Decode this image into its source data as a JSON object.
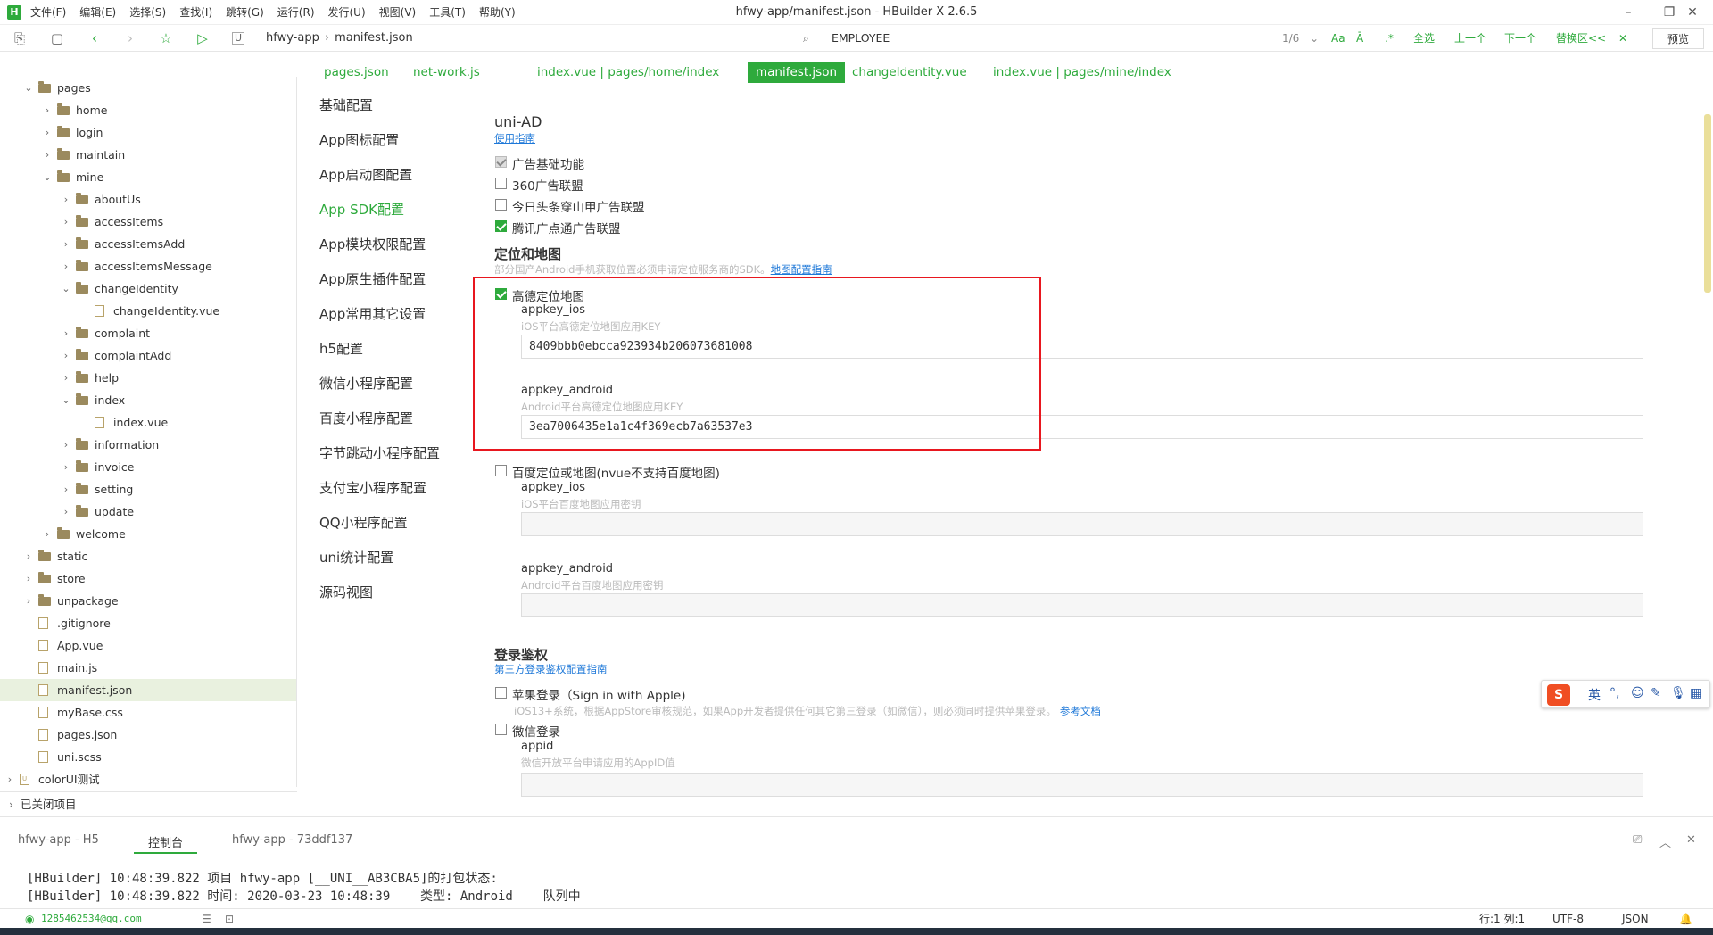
{
  "window": {
    "title": "hfwy-app/manifest.json - HBuilder X 2.6.5",
    "logo": "H"
  },
  "menu": [
    "文件(F)",
    "编辑(E)",
    "选择(S)",
    "查找(I)",
    "跳转(G)",
    "运行(R)",
    "发行(U)",
    "视图(V)",
    "工具(T)",
    "帮助(Y)"
  ],
  "breadcrumb": {
    "project": "hfwy-app",
    "file": "manifest.json"
  },
  "find": {
    "value": "EMPLOYEE",
    "count": "1/6",
    "case_label": "Aa",
    "word_label": "Ā",
    "regex_label": ".*",
    "select_all": "全选",
    "prev": "上一个",
    "next": "下一个",
    "replace": "替换区<<",
    "close": "✕",
    "preview": "预览"
  },
  "tree": [
    {
      "depth": 1,
      "type": "folder",
      "open": true,
      "label": "pages"
    },
    {
      "depth": 2,
      "type": "folder",
      "open": false,
      "label": "home"
    },
    {
      "depth": 2,
      "type": "folder",
      "open": false,
      "label": "login"
    },
    {
      "depth": 2,
      "type": "folder",
      "open": false,
      "label": "maintain"
    },
    {
      "depth": 2,
      "type": "folder",
      "open": true,
      "label": "mine"
    },
    {
      "depth": 3,
      "type": "folder",
      "open": false,
      "label": "aboutUs"
    },
    {
      "depth": 3,
      "type": "folder",
      "open": false,
      "label": "accessItems"
    },
    {
      "depth": 3,
      "type": "folder",
      "open": false,
      "label": "accessItemsAdd"
    },
    {
      "depth": 3,
      "type": "folder",
      "open": false,
      "label": "accessItemsMessage"
    },
    {
      "depth": 3,
      "type": "folder",
      "open": true,
      "label": "changeIdentity"
    },
    {
      "depth": 4,
      "type": "file",
      "label": "changeIdentity.vue"
    },
    {
      "depth": 3,
      "type": "folder",
      "open": false,
      "label": "complaint"
    },
    {
      "depth": 3,
      "type": "folder",
      "open": false,
      "label": "complaintAdd"
    },
    {
      "depth": 3,
      "type": "folder",
      "open": false,
      "label": "help"
    },
    {
      "depth": 3,
      "type": "folder",
      "open": true,
      "label": "index"
    },
    {
      "depth": 4,
      "type": "file",
      "label": "index.vue"
    },
    {
      "depth": 3,
      "type": "folder",
      "open": false,
      "label": "information"
    },
    {
      "depth": 3,
      "type": "folder",
      "open": false,
      "label": "invoice"
    },
    {
      "depth": 3,
      "type": "folder",
      "open": false,
      "label": "setting"
    },
    {
      "depth": 3,
      "type": "folder",
      "open": false,
      "label": "update"
    },
    {
      "depth": 2,
      "type": "folder",
      "open": false,
      "label": "welcome"
    },
    {
      "depth": 1,
      "type": "folder",
      "open": false,
      "label": "static"
    },
    {
      "depth": 1,
      "type": "folder",
      "open": false,
      "label": "store"
    },
    {
      "depth": 1,
      "type": "folder",
      "open": false,
      "label": "unpackage"
    },
    {
      "depth": 1,
      "type": "file",
      "label": ".gitignore"
    },
    {
      "depth": 1,
      "type": "file",
      "label": "App.vue"
    },
    {
      "depth": 1,
      "type": "file",
      "label": "main.js"
    },
    {
      "depth": 1,
      "type": "file",
      "label": "manifest.json",
      "selected": true
    },
    {
      "depth": 1,
      "type": "file",
      "label": "myBase.css"
    },
    {
      "depth": 1,
      "type": "file",
      "label": "pages.json"
    },
    {
      "depth": 1,
      "type": "file",
      "label": "uni.scss"
    },
    {
      "depth": 0,
      "type": "project",
      "open": false,
      "label": "colorUI测试"
    }
  ],
  "closed_projects": "已关闭项目",
  "tabs": [
    "pages.json",
    "net-work.js",
    "index.vue | pages/home/index",
    "manifest.json",
    "changeIdentity.vue",
    "index.vue | pages/mine/index"
  ],
  "active_tab": 3,
  "leftnav": [
    "基础配置",
    "App图标配置",
    "App启动图配置",
    "App SDK配置",
    "App模块权限配置",
    "App原生插件配置",
    "App常用其它设置",
    "h5配置",
    "微信小程序配置",
    "百度小程序配置",
    "字节跳动小程序配置",
    "支付宝小程序配置",
    "QQ小程序配置",
    "uni统计配置",
    "源码视图"
  ],
  "leftnav_active": 3,
  "uniad": {
    "title": "uni-AD",
    "guide": "使用指南",
    "options": [
      {
        "label": "广告基础功能",
        "state": "disabled"
      },
      {
        "label": "360广告联盟",
        "state": "off"
      },
      {
        "label": "今日头条穿山甲广告联盟",
        "state": "off"
      },
      {
        "label": "腾讯广点通广告联盟",
        "state": "on"
      }
    ]
  },
  "maps": {
    "title": "定位和地图",
    "hint": "部分国产Android手机获取位置必须申请定位服务商的SDK。",
    "hint_link": "地图配置指南",
    "amap": {
      "label": "高德定位地图",
      "checked": true,
      "ios_label": "appkey_ios",
      "ios_hint": "iOS平台高德定位地图应用KEY",
      "ios_value": "8409bbb0ebcca923934b206073681008",
      "android_label": "appkey_android",
      "android_hint": "Android平台高德定位地图应用KEY",
      "android_value": "3ea7006435e1a1c4f369ecb7a63537e3"
    },
    "baidu": {
      "label": "百度定位或地图(nvue不支持百度地图)",
      "checked": false,
      "ios_label": "appkey_ios",
      "ios_hint": "iOS平台百度地图应用密钥",
      "ios_value": "",
      "android_label": "appkey_android",
      "android_hint": "Android平台百度地图应用密钥",
      "android_value": ""
    }
  },
  "oauth": {
    "title": "登录鉴权",
    "guide": "第三方登录鉴权配置指南",
    "apple_label": "苹果登录（Sign in with Apple)",
    "apple_hint": "iOS13+系统，根据AppStore审核规范，如果App开发者提供任何其它第三登录（如微信），则必须同时提供苹果登录。",
    "apple_link": "参考文档",
    "wechat_label": "微信登录",
    "appid_label": "appid",
    "appid_hint": "微信开放平台申请应用的AppID值",
    "appid_value": ""
  },
  "ime": {
    "lang": "英",
    "punct": "°,"
  },
  "console": {
    "tabs": [
      "hfwy-app - H5",
      "控制台",
      "hfwy-app - 73ddf137"
    ],
    "active": 1,
    "lines": [
      "[HBuilder] 10:48:39.822 项目 hfwy-app [__UNI__AB3CBA5]的打包状态:",
      "[HBuilder] 10:48:39.822 时间: 2020-03-23 10:48:39    类型: Android    队列中"
    ]
  },
  "status": {
    "user": "1285462534@qq.com",
    "pos": "行:1  列:1",
    "encoding": "UTF-8",
    "lang": "JSON"
  },
  "colors": {
    "accent": "#2eaa3c",
    "highlight_border": "#e8171f",
    "link": "#1e78d8"
  }
}
